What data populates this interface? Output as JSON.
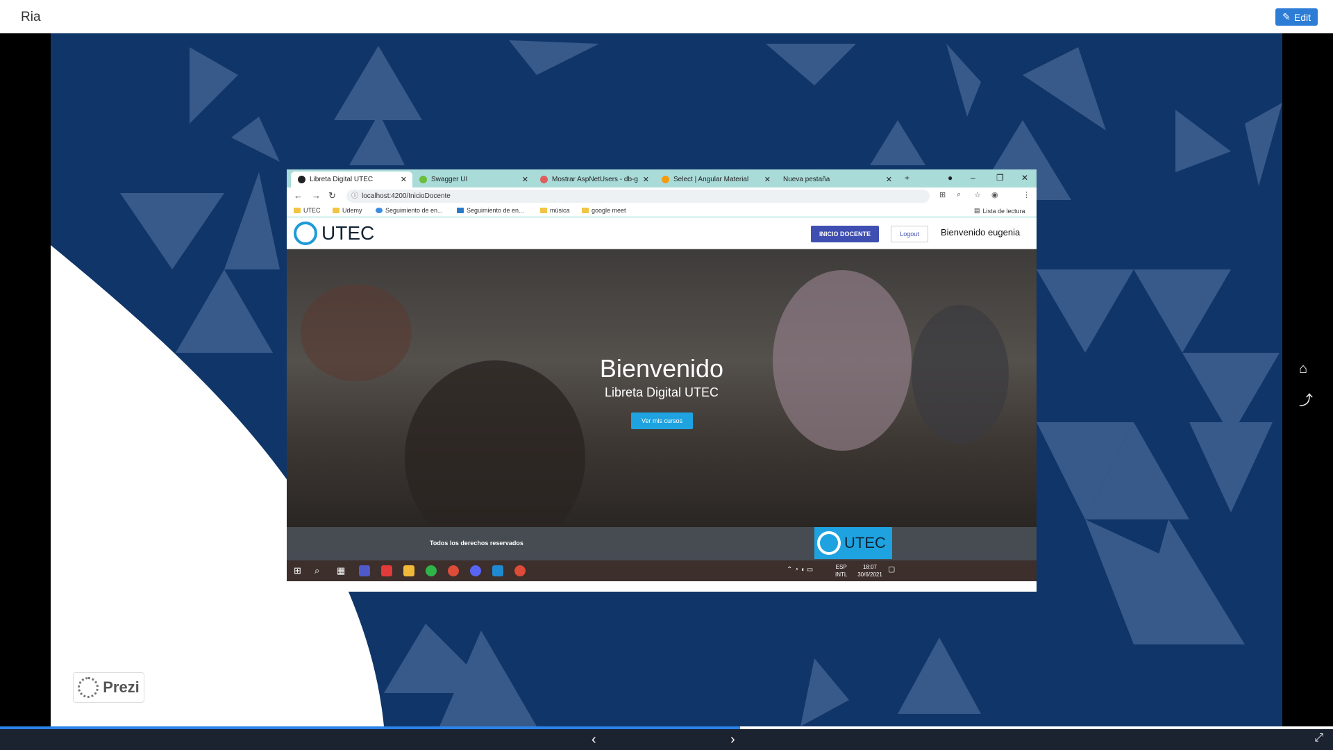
{
  "app": {
    "title": "Ria",
    "edit_label": "Edit"
  },
  "presentation": {
    "brand": "Prezi",
    "progress_fraction": 0.555
  },
  "browser": {
    "tabs": [
      {
        "label": "Libreta Digital UTEC",
        "active": true
      },
      {
        "label": "Swagger UI",
        "active": false
      },
      {
        "label": "Mostrar AspNetUsers - db-g",
        "active": false
      },
      {
        "label": "Select | Angular Material",
        "active": false
      },
      {
        "label": "Nueva pestaña",
        "active": false
      }
    ],
    "url": "localhost:4200/InicioDocente",
    "bookmarks": [
      "UTEC",
      "Udemy",
      "Seguimiento de en...",
      "Seguimiento de en...",
      "música",
      "google meet"
    ],
    "reading_list": "Lista de lectura"
  },
  "app_page": {
    "logo_text": "UTEC",
    "nav_button": "INICIO DOCENTE",
    "logout": "Logout",
    "welcome": "Bienvenido eugenia",
    "hero_title": "Bienvenido",
    "hero_subtitle": "Libreta Digital UTEC",
    "hero_button": "Ver mis cursos",
    "footer_rights": "Todos los derechos reservados",
    "footer_logo": "UTEC"
  },
  "taskbar": {
    "lang": "ESP",
    "layout": "INTL",
    "time": "18:07",
    "date": "30/6/2021"
  },
  "colors": {
    "slide_bg": "#103568",
    "accent": "#2d7cd6",
    "nav_button": "#3e4fb1",
    "hero_button": "#1ea3e0"
  }
}
